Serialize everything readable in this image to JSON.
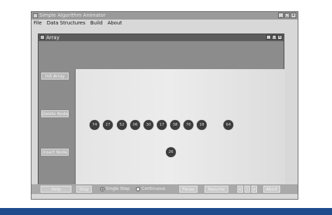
{
  "app": {
    "title": "Simple Algorithm Animator"
  },
  "window_buttons": {
    "minimize": "_",
    "maximize": "□",
    "close": "x"
  },
  "menu": {
    "items": [
      "File",
      "Data Structures",
      "Build",
      "About"
    ]
  },
  "inner_window": {
    "title": "Array"
  },
  "sidebar": {
    "init_label": "Init Array",
    "delete_label": "Delete Node",
    "insert_label": "Insert Node"
  },
  "array_nodes": [
    "74",
    "27",
    "52",
    "06",
    "30",
    "17",
    "38",
    "76",
    "18",
    "64"
  ],
  "floating_node": "26",
  "controls": {
    "help_label": "Help",
    "step_label": "Step",
    "single_step_label": "Single Step",
    "continuous_label": "Continuous",
    "pause_label": "Pause",
    "resume_label": "Resume",
    "slow_label": "<",
    "speed_label": "|",
    "fast_label": ">",
    "abort_label": "Abort"
  },
  "colors": {
    "bottom_bar": "#1f4a8c",
    "node_fill": "#3d3d3d"
  }
}
